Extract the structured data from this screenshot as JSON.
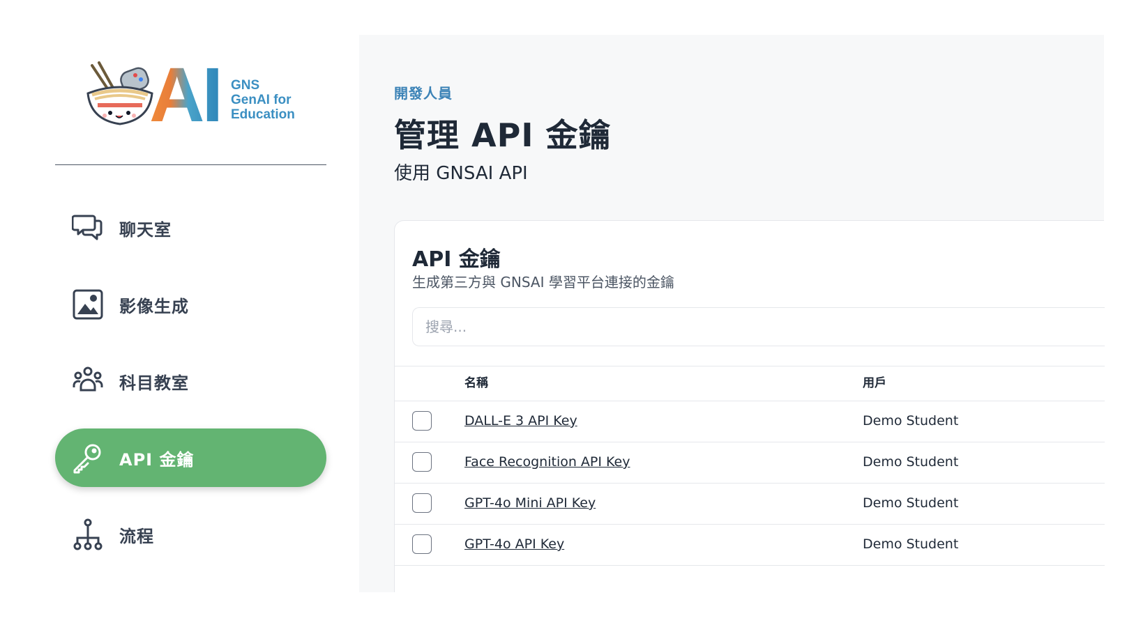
{
  "logo": {
    "ai_text": "AI",
    "lines": [
      "GNS",
      "GenAI for",
      "Education"
    ]
  },
  "sidebar": {
    "items": [
      {
        "label": "聊天室",
        "icon": "chat-bubbles-icon",
        "active": false
      },
      {
        "label": "影像生成",
        "icon": "image-icon",
        "active": false
      },
      {
        "label": "科目教室",
        "icon": "users-group-icon",
        "active": false
      },
      {
        "label": "API 金鑰",
        "icon": "key-icon",
        "active": true
      },
      {
        "label": "流程",
        "icon": "flow-tree-icon",
        "active": false
      }
    ],
    "active_color": "#63b472"
  },
  "header": {
    "eyebrow": "開發人員",
    "title": "管理 API 金鑰",
    "subtitle": "使用 GNSAI API"
  },
  "card": {
    "title": "API 金鑰",
    "description": "生成第三方與 GNSAI 學習平台連接的金鑰",
    "search_placeholder": "搜尋..."
  },
  "table": {
    "columns": [
      "名稱",
      "用戶"
    ],
    "rows": [
      {
        "name": "DALL-E 3 API Key",
        "user": "Demo Student"
      },
      {
        "name": "Face Recognition API Key",
        "user": "Demo Student"
      },
      {
        "name": "GPT-4o Mini API Key",
        "user": "Demo Student"
      },
      {
        "name": "GPT-4o API Key",
        "user": "Demo Student"
      }
    ]
  }
}
